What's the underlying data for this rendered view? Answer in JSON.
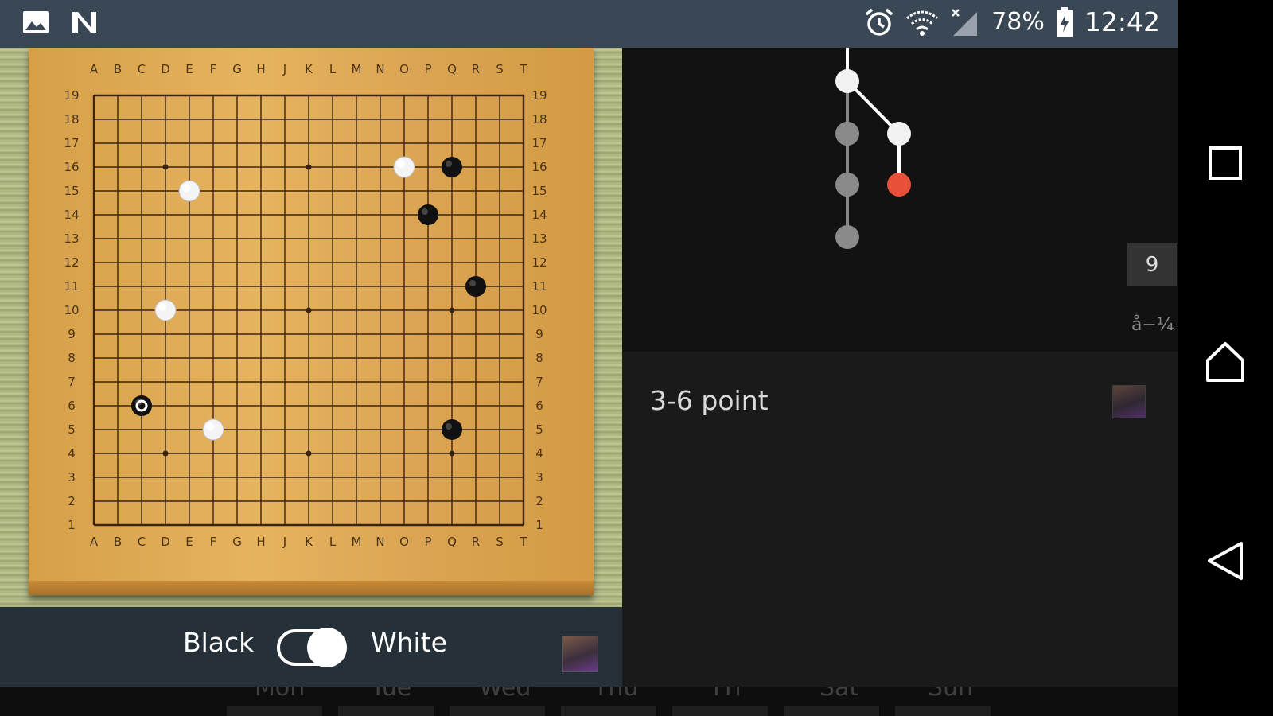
{
  "status_bar": {
    "battery": "78%",
    "time": "12:42"
  },
  "board": {
    "columns": [
      "A",
      "B",
      "C",
      "D",
      "E",
      "F",
      "G",
      "H",
      "J",
      "K",
      "L",
      "M",
      "N",
      "O",
      "P",
      "Q",
      "R",
      "S",
      "T"
    ],
    "rows": [
      "19",
      "18",
      "17",
      "16",
      "15",
      "14",
      "13",
      "12",
      "11",
      "10",
      "9",
      "8",
      "7",
      "6",
      "5",
      "4",
      "3",
      "2",
      "1"
    ],
    "stones": [
      {
        "point": "O16",
        "color": "white"
      },
      {
        "point": "Q16",
        "color": "black"
      },
      {
        "point": "E15",
        "color": "white"
      },
      {
        "point": "P14",
        "color": "black"
      },
      {
        "point": "R11",
        "color": "black"
      },
      {
        "point": "D10",
        "color": "white"
      },
      {
        "point": "C6",
        "color": "black",
        "last_move": true
      },
      {
        "point": "F5",
        "color": "white"
      },
      {
        "point": "Q5",
        "color": "black"
      }
    ]
  },
  "toggle": {
    "left_label": "Black",
    "right_label": "White",
    "state": "white"
  },
  "tree": {
    "move_number": "9",
    "garbled_text": "å−¼"
  },
  "comment": {
    "text": "3-6 point"
  },
  "days": [
    "Mon",
    "Tue",
    "Wed",
    "Thu",
    "Fri",
    "Sat",
    "Sun"
  ],
  "colors": {
    "status_bar": "#3a4856",
    "board": "#e0ac56",
    "current_node": "#e8503a",
    "bottom_bar": "#263038"
  }
}
